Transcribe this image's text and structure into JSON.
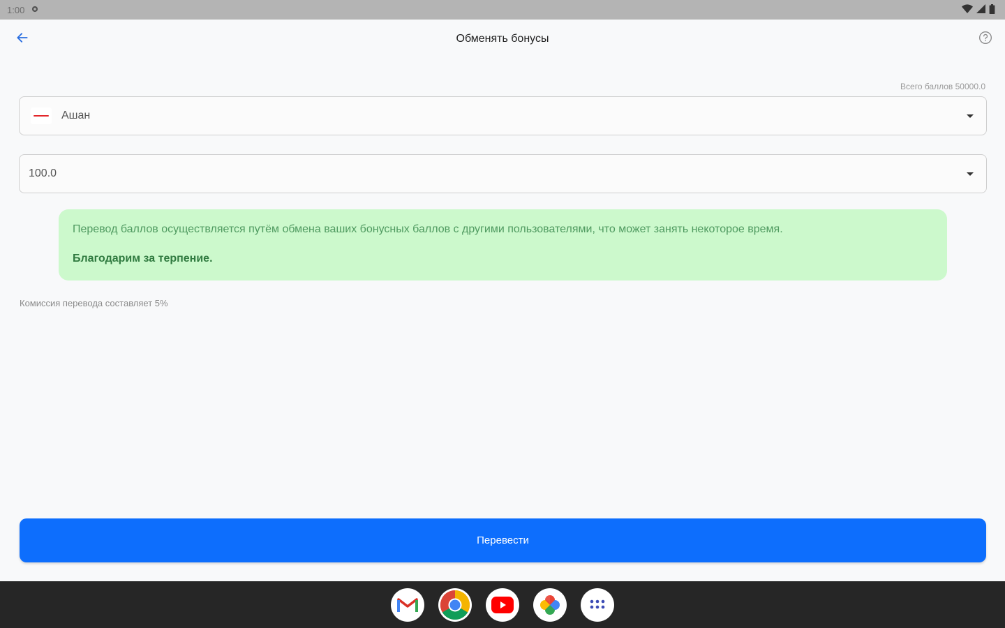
{
  "status_bar": {
    "time": "1:00"
  },
  "app_bar": {
    "title": "Обменять бонусы",
    "back_icon": "arrow-left-icon",
    "help_icon": "help-circle-icon"
  },
  "total_points": "Всего баллов 50000.0",
  "store_select": {
    "selected": "Ашан"
  },
  "amount_select": {
    "selected": "100.0"
  },
  "info": {
    "text": "Перевод баллов осуществляется путём обмена ваших бонусных баллов с другими пользователями, что может занять некоторое время.",
    "thanks": "Благодарим за терпение."
  },
  "commission": "Комиссия перевода составляет 5%",
  "submit_button": "Перевести",
  "dock": {
    "apps": [
      "gmail-icon",
      "chrome-icon",
      "youtube-icon",
      "photos-icon",
      "app-drawer-icon"
    ]
  },
  "colors": {
    "accent": "#0d6efd",
    "info_bg": "#ccf9cc",
    "info_text": "#4f9a60"
  }
}
